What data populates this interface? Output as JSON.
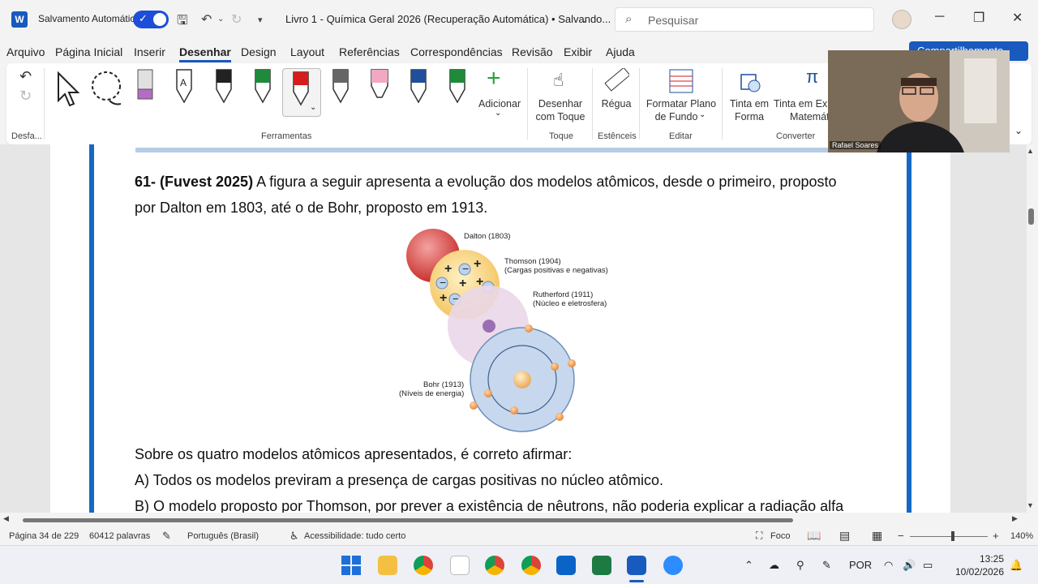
{
  "titlebar": {
    "autosave_label": "Salvamento Automático",
    "doc_title": "Livro 1 - Química Geral 2026 (Recuperação Automática) • Salvando...",
    "search_placeholder": "Pesquisar"
  },
  "menu": {
    "items": [
      "Arquivo",
      "Página Inicial",
      "Inserir",
      "Desenhar",
      "Design",
      "Layout",
      "Referências",
      "Correspondências",
      "Revisão",
      "Exibir",
      "Ajuda"
    ],
    "active": "Desenhar",
    "share_label": "Compartilhamento"
  },
  "ribbon": {
    "undo_group": "Desfa...",
    "tools_group": "Ferramentas",
    "add_label": "Adicionar",
    "touch_draw_label_1": "Desenhar",
    "touch_draw_label_2": "com Toque",
    "touch_group": "Toque",
    "ruler_label": "Régua",
    "stencils_group": "Estênceis",
    "format_bg_label_1": "Formatar Plano",
    "format_bg_label_2": "de Fundo",
    "edit_group": "Editar",
    "ink_shape_1": "Tinta em",
    "ink_shape_2": "Forma",
    "ink_math_1": "Tinta em Exp",
    "ink_math_2": "Matemát",
    "convert_group": "Converter",
    "pen_colors": [
      "#222222",
      "#1e8a3a",
      "#d81b1b",
      "#555555",
      "#f2a7c3",
      "#1f4e9c",
      "#1e8a3a"
    ]
  },
  "document": {
    "question_bold": "61- (Fuvest 2025)",
    "question_text": " A figura a seguir apresenta a evolução dos modelos atômicos, desde o primeiro, proposto",
    "question_line2": "por Dalton em 1803, até o de Bohr, proposto em 1913.",
    "figure": {
      "dalton": "Dalton (1803)",
      "thomson_1": "Thomson (1904)",
      "thomson_2": "(Cargas positivas e negativas)",
      "rutherford_1": "Rutherford (1911)",
      "rutherford_2": "(Núcleo e eletrosfera)",
      "bohr_1": "Bohr (1913)",
      "bohr_2": "(Níveis de energia)"
    },
    "prompt": "Sobre os quatro modelos atômicos apresentados, é correto afirmar:",
    "option_a": "A) Todos os modelos previram a presença de cargas positivas no núcleo atômico.",
    "option_b": "B) O modelo proposto por Thomson, por prever a existência de nêutrons, não poderia explicar a radiação alfa"
  },
  "status": {
    "page": "Página 34 de 229",
    "words": "60412 palavras",
    "language": "Português (Brasil)",
    "accessibility": "Acessibilidade: tudo certo",
    "focus": "Foco",
    "zoom": "140%"
  },
  "webcam": {
    "name": "Rafael Soares"
  },
  "taskbar": {
    "lang": "POR",
    "time": "13:25",
    "date": "10/02/2026"
  }
}
